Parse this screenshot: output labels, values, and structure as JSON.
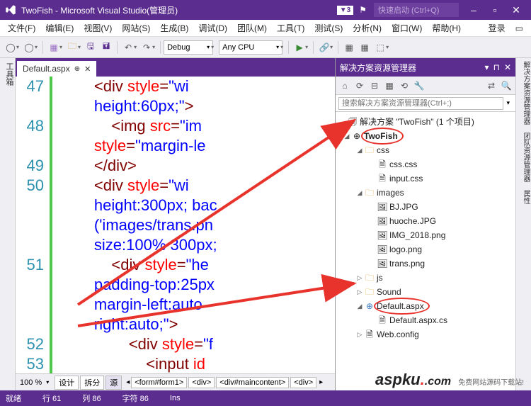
{
  "titlebar": {
    "title": "TwoFish - Microsoft Visual Studio(管理员)",
    "badge": "▼3",
    "quicklaunch_placeholder": "快速启动 (Ctrl+Q)"
  },
  "menu": {
    "items": [
      "文件(F)",
      "编辑(E)",
      "视图(V)",
      "网站(S)",
      "生成(B)",
      "调试(D)",
      "团队(M)",
      "工具(T)",
      "测试(S)",
      "分析(N)",
      "窗口(W)",
      "帮助(H)"
    ],
    "login": "登录"
  },
  "toolbar": {
    "config": "Debug",
    "platform": "Any CPU"
  },
  "left_strip": "工具箱",
  "right_strip": "解决方案资源管理器  团队资源管理器  属性",
  "editor": {
    "tab": "Default.aspx",
    "zoom": "100 %",
    "bottom_buttons": [
      "设计",
      "拆分",
      "源"
    ],
    "breadcrumbs": [
      "<form#form1>",
      "<div>",
      "<div#maincontent>",
      "<div>"
    ],
    "gutter": [
      "47",
      "",
      "48",
      "",
      "49",
      "50",
      "",
      "",
      "",
      "51",
      "",
      "",
      "",
      "52",
      "53"
    ],
    "lines": [
      {
        "indent": "        ",
        "parts": [
          {
            "c": "tag",
            "t": "<div "
          },
          {
            "c": "attr",
            "t": "style"
          },
          {
            "c": "tag",
            "t": "="
          },
          {
            "c": "str",
            "t": "\"wi"
          }
        ]
      },
      {
        "indent": "        ",
        "parts": [
          {
            "c": "str",
            "t": "height:60px;\""
          },
          {
            "c": "tag",
            "t": ">"
          }
        ]
      },
      {
        "indent": "            ",
        "parts": [
          {
            "c": "tag",
            "t": "<img "
          },
          {
            "c": "attr",
            "t": "src"
          },
          {
            "c": "tag",
            "t": "="
          },
          {
            "c": "str",
            "t": "\"im"
          }
        ]
      },
      {
        "indent": "        ",
        "parts": [
          {
            "c": "attr",
            "t": "style"
          },
          {
            "c": "tag",
            "t": "="
          },
          {
            "c": "str",
            "t": "\"margin-le"
          }
        ]
      },
      {
        "indent": "        ",
        "parts": [
          {
            "c": "tag",
            "t": "</div>"
          }
        ]
      },
      {
        "indent": "        ",
        "parts": [
          {
            "c": "tag",
            "t": "<div "
          },
          {
            "c": "attr",
            "t": "style"
          },
          {
            "c": "tag",
            "t": "="
          },
          {
            "c": "str",
            "t": "\"wi"
          }
        ]
      },
      {
        "indent": "        ",
        "parts": [
          {
            "c": "str",
            "t": "height:300px; bac"
          }
        ]
      },
      {
        "indent": "        ",
        "parts": [
          {
            "c": "str",
            "t": "('images/trans.pn"
          }
        ]
      },
      {
        "indent": "        ",
        "parts": [
          {
            "c": "str",
            "t": "size:100% 300px;"
          }
        ]
      },
      {
        "indent": "            ",
        "parts": [
          {
            "c": "tag",
            "t": "<div "
          },
          {
            "c": "attr",
            "t": "style"
          },
          {
            "c": "tag",
            "t": "="
          },
          {
            "c": "str",
            "t": "\"he"
          }
        ]
      },
      {
        "indent": "        ",
        "parts": [
          {
            "c": "str",
            "t": "padding-top:25px"
          }
        ]
      },
      {
        "indent": "        ",
        "parts": [
          {
            "c": "str",
            "t": "margin-left:auto"
          }
        ]
      },
      {
        "indent": "        ",
        "parts": [
          {
            "c": "str",
            "t": "right:auto;\""
          },
          {
            "c": "tag",
            "t": ">"
          }
        ]
      },
      {
        "indent": "                ",
        "parts": [
          {
            "c": "tag",
            "t": "<div "
          },
          {
            "c": "attr",
            "t": "style"
          },
          {
            "c": "tag",
            "t": "="
          },
          {
            "c": "str",
            "t": "\"f"
          }
        ]
      },
      {
        "indent": "                    ",
        "parts": [
          {
            "c": "tag",
            "t": "<input "
          },
          {
            "c": "attr",
            "t": "id"
          }
        ]
      }
    ]
  },
  "solution": {
    "title": "解决方案资源管理器",
    "search_placeholder": "搜索解决方案资源管理器(Ctrl+;)",
    "root": "解决方案 \"TwoFish\" (1 个项目)",
    "project": "TwoFish",
    "folders": {
      "css": [
        "css.css",
        "input.css"
      ],
      "images": [
        "BJ.JPG",
        "huoche.JPG",
        "IMG_2018.png",
        "logo.png",
        "trans.png"
      ],
      "js": "js",
      "sound": "Sound"
    },
    "default_aspx": "Default.aspx",
    "default_aspx_cs": "Default.aspx.cs",
    "web_config": "Web.config"
  },
  "status": {
    "ready": "就绪",
    "line": "行 61",
    "col": "列 86",
    "char": "字符 86",
    "ins": "Ins"
  },
  "watermark": {
    "main": "aspku",
    "suffix": ".com",
    "sub": "免费网站源码下载站!"
  }
}
